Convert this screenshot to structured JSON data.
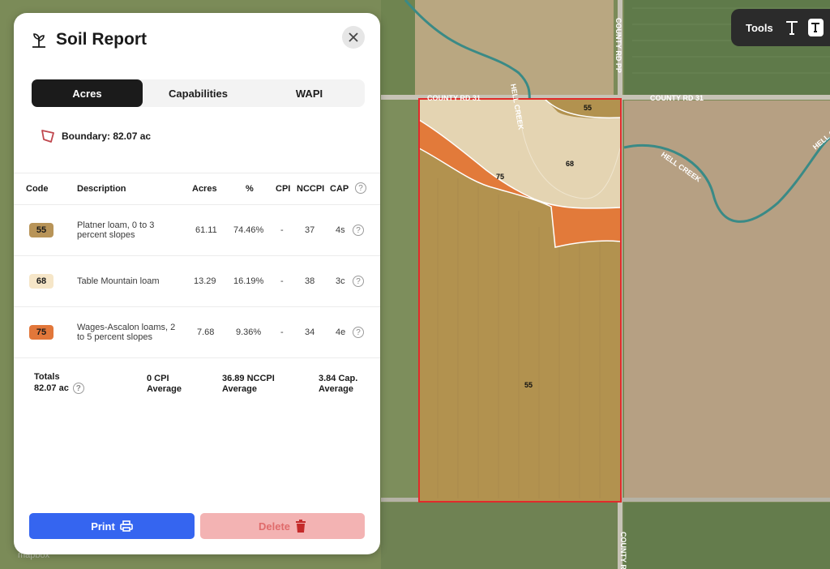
{
  "map": {
    "roads": [
      "COUNTY RD PP",
      "COUNTY RD 31",
      "COUNTY RD 31",
      "COUNTY RD PP"
    ],
    "creeks": [
      "HELL CREEK",
      "HELL CREEK",
      "HELL CREEK"
    ],
    "zone_labels": [
      "55",
      "68",
      "75",
      "55"
    ],
    "watermark": "mapbox",
    "zone_colors": {
      "55": "#b2924f",
      "68": "#e4d4b2",
      "75": "#e27a3a"
    }
  },
  "tools": {
    "label": "Tools"
  },
  "panel": {
    "title": "Soil Report",
    "tabs": [
      {
        "label": "Acres",
        "active": true
      },
      {
        "label": "Capabilities",
        "active": false
      },
      {
        "label": "WAPI",
        "active": false
      }
    ],
    "boundary": "Boundary: 82.07 ac",
    "table": {
      "headers": [
        "Code",
        "Description",
        "Acres",
        "%",
        "CPI",
        "NCCPI",
        "CAP"
      ],
      "help_glyph": "?",
      "rows": [
        {
          "code": "55",
          "color": "#b89458",
          "description": "Platner loam, 0 to 3 percent slopes",
          "acres": "61.11",
          "percent": "74.46%",
          "cpi": "-",
          "nccpi": "37",
          "cap": "4s"
        },
        {
          "code": "68",
          "color": "#f6e6c8",
          "description": "Table Mountain loam",
          "acres": "13.29",
          "percent": "16.19%",
          "cpi": "-",
          "nccpi": "38",
          "cap": "3c"
        },
        {
          "code": "75",
          "color": "#e2773a",
          "description": "Wages-Ascalon loams, 2 to 5 percent slopes",
          "acres": "7.68",
          "percent": "9.36%",
          "cpi": "-",
          "nccpi": "34",
          "cap": "4e"
        }
      ]
    },
    "totals": {
      "label": "Totals",
      "acres": "82.07 ac",
      "cpi": [
        "0 CPI",
        "Average"
      ],
      "nccpi": [
        "36.89 NCCPI",
        "Average"
      ],
      "cap": [
        "3.84 Cap.",
        "Average"
      ]
    },
    "print_label": "Print",
    "delete_label": "Delete"
  }
}
